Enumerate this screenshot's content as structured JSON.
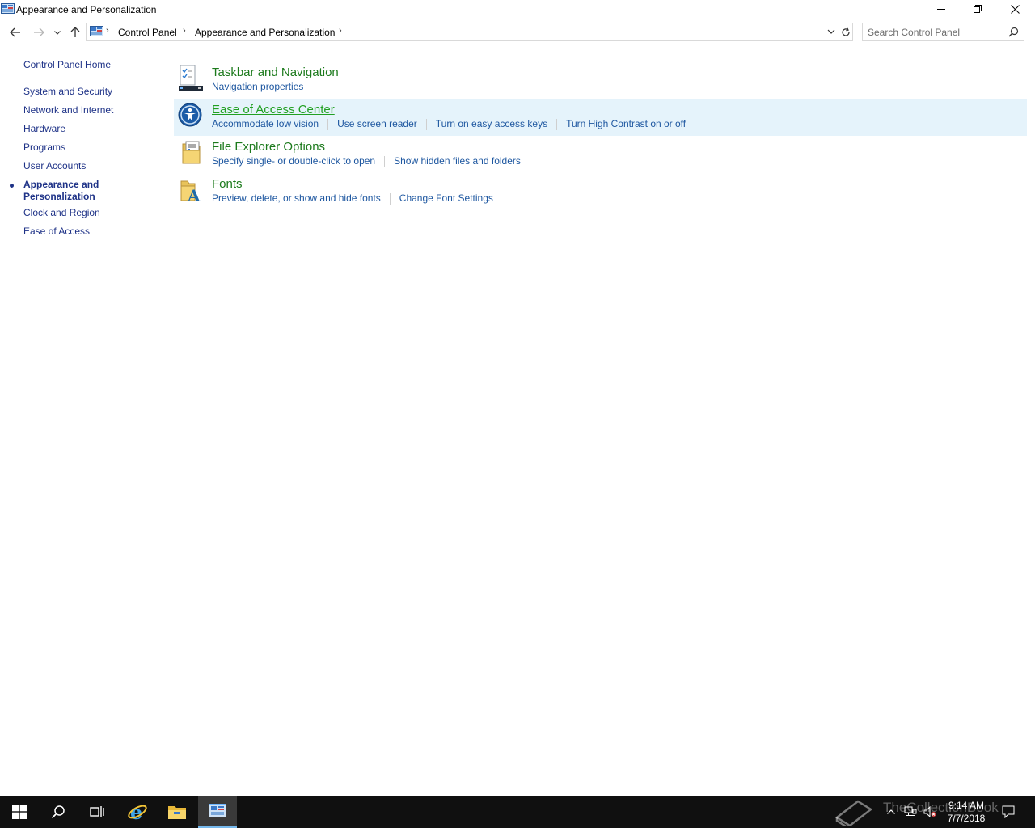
{
  "window": {
    "title": "Appearance and Personalization"
  },
  "address": {
    "crumbs": [
      "Control Panel",
      "Appearance and Personalization"
    ]
  },
  "search": {
    "placeholder": "Search Control Panel"
  },
  "leftnav": {
    "home": "Control Panel Home",
    "items": [
      "System and Security",
      "Network and Internet",
      "Hardware",
      "Programs",
      "User Accounts",
      "Appearance and",
      "Personalization",
      "Clock and Region",
      "Ease of Access"
    ]
  },
  "categories": [
    {
      "title": "Taskbar and Navigation",
      "icon": "taskbar-icon",
      "tasks": [
        "Navigation properties"
      ]
    },
    {
      "title": "Ease of Access Center",
      "icon": "ease-of-access-icon",
      "tasks": [
        "Accommodate low vision",
        "Use screen reader",
        "Turn on easy access keys",
        "Turn High Contrast on or off"
      ]
    },
    {
      "title": "File Explorer Options",
      "icon": "folder-options-icon",
      "tasks": [
        "Specify single- or double-click to open",
        "Show hidden files and folders"
      ]
    },
    {
      "title": "Fonts",
      "icon": "fonts-icon",
      "tasks": [
        "Preview, delete, or show and hide fonts",
        "Change Font Settings"
      ]
    }
  ],
  "taskbar": {
    "time": "9:14 AM",
    "date": "7/7/2018",
    "watermark": "TheCollectionBook"
  },
  "colors": {
    "category_title": "#1c7a1c",
    "task_link": "#1e57a0",
    "nav_link": "#1e3287",
    "highlight": "#e5f3fb",
    "taskbar": "#101010"
  }
}
